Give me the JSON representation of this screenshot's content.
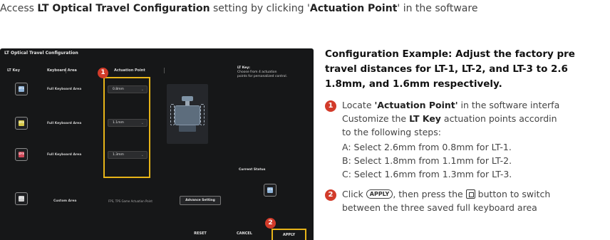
{
  "intro": {
    "prefix": "Access ",
    "bold1": "LT Optical Travel Configuration",
    "middle": " setting by clicking '",
    "bold2": "Actuation Point",
    "suffix": "' in the software"
  },
  "software": {
    "title": "LT Optical Travel Configuration",
    "headers": {
      "lt_key": "LT Key",
      "keyboard_area": "Keyboard Area",
      "actuation_point": "Actuation Point"
    },
    "lt_info": {
      "title": "LT Key:",
      "desc": "Choose from 4 actuation points for personalized control."
    },
    "rows": [
      {
        "key": "LT-1",
        "area": "Full Keyboard Area",
        "value": "0.8mm",
        "color": "#8fb4d9"
      },
      {
        "key": "LT-2",
        "area": "Full Keyboard Area",
        "value": "1.1mm",
        "color": "#d6c848"
      },
      {
        "key": "LT-3",
        "area": "Full Keyboard Area",
        "value": "1.3mm",
        "color": "#d04a5a"
      }
    ],
    "custom_row": {
      "key": "LT-4",
      "area": "Custom Area",
      "note": "FPS, TPS Game Actuation Point",
      "button": "Advance Setting"
    },
    "current_status": "Current Status",
    "status_key": "LT-1",
    "buttons": {
      "reset": "RESET",
      "cancel": "CANCEL",
      "apply": "APPLY"
    },
    "callout_1": "1",
    "callout_2": "2",
    "highlight_color": "#e7b418"
  },
  "instructions": {
    "title_line1": "Configuration Example: Adjust the factory pre",
    "title_line2": "travel distances for LT-1, LT-2, and LT-3 to 2.6",
    "title_line3": "1.8mm, and 1.6mm respectively.",
    "step1": {
      "num": "1",
      "line1_prefix": "Locate ",
      "line1_bold": "'Actuation Point'",
      "line1_suffix": " in the software interfa",
      "line2_prefix": "Customize the ",
      "line2_bold": "LT Key",
      "line2_suffix": " actuation points accordin",
      "line3": "to the following steps:",
      "a": "A: Select 2.6mm from 0.8mm for LT-1.",
      "b": "B: Select 1.8mm from 1.1mm for LT-2.",
      "c": "C: Select 1.6mm from 1.3mm for LT-3."
    },
    "step2": {
      "num": "2",
      "prefix": "Click ",
      "apply_pill": "APPLY",
      "middle": ", then press the ",
      "suffix": " button to switch",
      "line2": "between the three saved full keyboard area"
    }
  }
}
